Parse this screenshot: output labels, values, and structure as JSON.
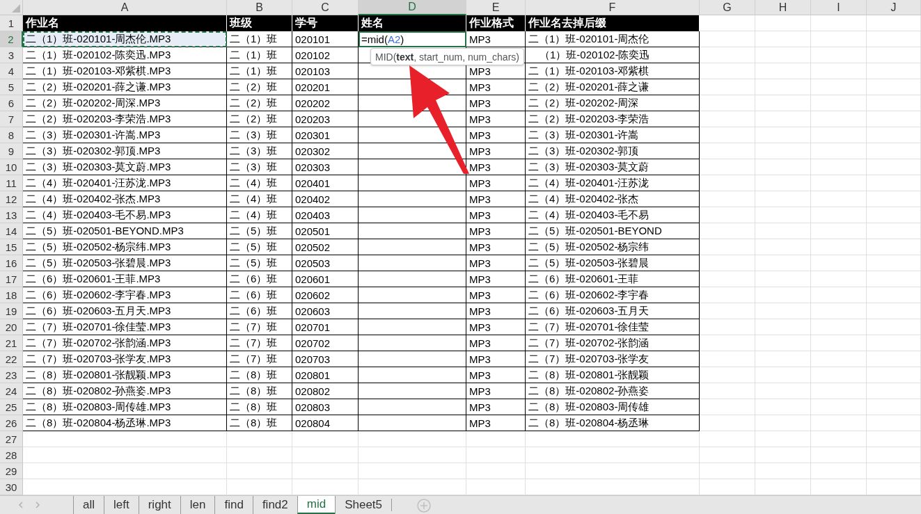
{
  "column_headers": [
    {
      "label": "A",
      "selected": false
    },
    {
      "label": "B",
      "selected": false
    },
    {
      "label": "C",
      "selected": false
    },
    {
      "label": "D",
      "selected": true
    },
    {
      "label": "E",
      "selected": false
    },
    {
      "label": "F",
      "selected": false
    },
    {
      "label": "G",
      "selected": false
    },
    {
      "label": "H",
      "selected": false
    },
    {
      "label": "I",
      "selected": false
    },
    {
      "label": "J",
      "selected": false
    }
  ],
  "rows": [
    {
      "number": "1",
      "kind": "header",
      "selected": false,
      "cells": [
        "作业名",
        "班级",
        "学号",
        "姓名",
        "作业格式",
        "作业名去掉后缀"
      ]
    },
    {
      "number": "2",
      "kind": "data",
      "selected": true,
      "copied": true,
      "cells": [
        "二（1）班-020101-周杰伦.MP3",
        "二（1）班",
        "020101",
        "",
        "MP3",
        "二（1）班-020101-周杰伦"
      ],
      "editing": {
        "prefix": "=mid(",
        "ref": "A2",
        "suffix": ")"
      }
    },
    {
      "number": "3",
      "kind": "data",
      "selected": false,
      "cells": [
        "二（1）班-020102-陈奕迅.MP3",
        "二（1）班",
        "020102",
        "",
        "",
        "（1）班-020102-陈奕迅"
      ]
    },
    {
      "number": "4",
      "kind": "data",
      "selected": false,
      "cells": [
        "二（1）班-020103-邓紫棋.MP3",
        "二（1）班",
        "020103",
        "",
        "MP3",
        "二（1）班-020103-邓紫棋"
      ]
    },
    {
      "number": "5",
      "kind": "data",
      "selected": false,
      "cells": [
        "二（2）班-020201-薛之谦.MP3",
        "二（2）班",
        "020201",
        "",
        "MP3",
        "二（2）班-020201-薛之谦"
      ]
    },
    {
      "number": "6",
      "kind": "data",
      "selected": false,
      "cells": [
        "二（2）班-020202-周深.MP3",
        "二（2）班",
        "020202",
        "",
        "MP3",
        "二（2）班-020202-周深"
      ]
    },
    {
      "number": "7",
      "kind": "data",
      "selected": false,
      "cells": [
        "二（2）班-020203-李荣浩.MP3",
        "二（2）班",
        "020203",
        "",
        "MP3",
        "二（2）班-020203-李荣浩"
      ]
    },
    {
      "number": "8",
      "kind": "data",
      "selected": false,
      "cells": [
        "二（3）班-020301-许嵩.MP3",
        "二（3）班",
        "020301",
        "",
        "MP3",
        "二（3）班-020301-许嵩"
      ]
    },
    {
      "number": "9",
      "kind": "data",
      "selected": false,
      "cells": [
        "二（3）班-020302-郭顶.MP3",
        "二（3）班",
        "020302",
        "",
        "MP3",
        "二（3）班-020302-郭顶"
      ]
    },
    {
      "number": "10",
      "kind": "data",
      "selected": false,
      "cells": [
        "二（3）班-020303-莫文蔚.MP3",
        "二（3）班",
        "020303",
        "",
        "MP3",
        "二（3）班-020303-莫文蔚"
      ]
    },
    {
      "number": "11",
      "kind": "data",
      "selected": false,
      "cells": [
        "二（4）班-020401-汪苏泷.MP3",
        "二（4）班",
        "020401",
        "",
        "MP3",
        "二（4）班-020401-汪苏泷"
      ]
    },
    {
      "number": "12",
      "kind": "data",
      "selected": false,
      "cells": [
        "二（4）班-020402-张杰.MP3",
        "二（4）班",
        "020402",
        "",
        "MP3",
        "二（4）班-020402-张杰"
      ]
    },
    {
      "number": "13",
      "kind": "data",
      "selected": false,
      "cells": [
        "二（4）班-020403-毛不易.MP3",
        "二（4）班",
        "020403",
        "",
        "MP3",
        "二（4）班-020403-毛不易"
      ]
    },
    {
      "number": "14",
      "kind": "data",
      "selected": false,
      "cells": [
        "二（5）班-020501-BEYOND.MP3",
        "二（5）班",
        "020501",
        "",
        "MP3",
        "二（5）班-020501-BEYOND"
      ]
    },
    {
      "number": "15",
      "kind": "data",
      "selected": false,
      "cells": [
        "二（5）班-020502-杨宗纬.MP3",
        "二（5）班",
        "020502",
        "",
        "MP3",
        "二（5）班-020502-杨宗纬"
      ]
    },
    {
      "number": "16",
      "kind": "data",
      "selected": false,
      "cells": [
        "二（5）班-020503-张碧晨.MP3",
        "二（5）班",
        "020503",
        "",
        "MP3",
        "二（5）班-020503-张碧晨"
      ]
    },
    {
      "number": "17",
      "kind": "data",
      "selected": false,
      "cells": [
        "二（6）班-020601-王菲.MP3",
        "二（6）班",
        "020601",
        "",
        "MP3",
        "二（6）班-020601-王菲"
      ]
    },
    {
      "number": "18",
      "kind": "data",
      "selected": false,
      "cells": [
        "二（6）班-020602-李宇春.MP3",
        "二（6）班",
        "020602",
        "",
        "MP3",
        "二（6）班-020602-李宇春"
      ]
    },
    {
      "number": "19",
      "kind": "data",
      "selected": false,
      "cells": [
        "二（6）班-020603-五月天.MP3",
        "二（6）班",
        "020603",
        "",
        "MP3",
        "二（6）班-020603-五月天"
      ]
    },
    {
      "number": "20",
      "kind": "data",
      "selected": false,
      "cells": [
        "二（7）班-020701-徐佳莹.MP3",
        "二（7）班",
        "020701",
        "",
        "MP3",
        "二（7）班-020701-徐佳莹"
      ]
    },
    {
      "number": "21",
      "kind": "data",
      "selected": false,
      "cells": [
        "二（7）班-020702-张韵涵.MP3",
        "二（7）班",
        "020702",
        "",
        "MP3",
        "二（7）班-020702-张韵涵"
      ]
    },
    {
      "number": "22",
      "kind": "data",
      "selected": false,
      "cells": [
        "二（7）班-020703-张学友.MP3",
        "二（7）班",
        "020703",
        "",
        "MP3",
        "二（7）班-020703-张学友"
      ]
    },
    {
      "number": "23",
      "kind": "data",
      "selected": false,
      "cells": [
        "二（8）班-020801-张靓颖.MP3",
        "二（8）班",
        "020801",
        "",
        "MP3",
        "二（8）班-020801-张靓颖"
      ]
    },
    {
      "number": "24",
      "kind": "data",
      "selected": false,
      "cells": [
        "二（8）班-020802-孙燕姿.MP3",
        "二（8）班",
        "020802",
        "",
        "MP3",
        "二（8）班-020802-孙燕姿"
      ]
    },
    {
      "number": "25",
      "kind": "data",
      "selected": false,
      "cells": [
        "二（8）班-020803-周传雄.MP3",
        "二（8）班",
        "020803",
        "",
        "MP3",
        "二（8）班-020803-周传雄"
      ]
    },
    {
      "number": "26",
      "kind": "data",
      "selected": false,
      "cells": [
        "二（8）班-020804-杨丞琳.MP3",
        "二（8）班",
        "020804",
        "",
        "MP3",
        "二（8）班-020804-杨丞琳"
      ]
    },
    {
      "number": "27",
      "kind": "empty",
      "selected": false
    },
    {
      "number": "28",
      "kind": "empty",
      "selected": false
    },
    {
      "number": "29",
      "kind": "empty",
      "selected": false
    },
    {
      "number": "30",
      "kind": "empty",
      "selected": false
    }
  ],
  "tooltip": "MID(**text**, start_num, num_chars)",
  "sheet_tabs": [
    {
      "label": "all",
      "selected": false
    },
    {
      "label": "left",
      "selected": false
    },
    {
      "label": "right",
      "selected": false
    },
    {
      "label": "len",
      "selected": false
    },
    {
      "label": "find",
      "selected": false
    },
    {
      "label": "find2",
      "selected": false
    },
    {
      "label": "mid",
      "selected": true
    },
    {
      "label": "Sheet5",
      "selected": false
    }
  ]
}
